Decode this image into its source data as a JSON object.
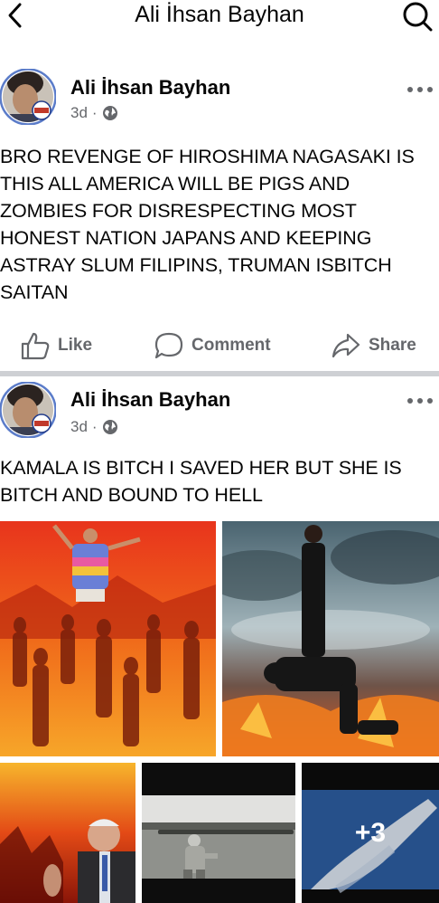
{
  "header": {
    "title": "Ali İhsan Bayhan",
    "back_icon": "chevron-left-icon",
    "search_icon": "search-icon"
  },
  "posts": [
    {
      "author": "Ali İhsan Bayhan",
      "time": "3d",
      "separator": "·",
      "audience_icon": "globe-icon",
      "text": "BRO REVENGE OF HIROSHIMA NAGASAKI IS THIS ALL AMERICA WILL BE PIGS AND ZOMBIES FOR DISRESPECTING MOST HONEST NATION JAPANS AND KEEPING ASTRAY SLUM FILIPINS, TRUMAN ISBITCH SAITAN",
      "actions": {
        "like": "Like",
        "comment": "Comment",
        "share": "Share"
      }
    },
    {
      "author": "Ali İhsan Bayhan",
      "time": "3d",
      "separator": "·",
      "audience_icon": "globe-icon",
      "text": "KAMALA IS BITCH I SAVED HER BUT SHE IS BITCH AND BOUND TO HELL",
      "more_photos": "+3"
    }
  ],
  "colors": {
    "secondary_text": "#65676b",
    "divider": "#ced0d4",
    "avatar_ring": "#5b7cc9"
  }
}
